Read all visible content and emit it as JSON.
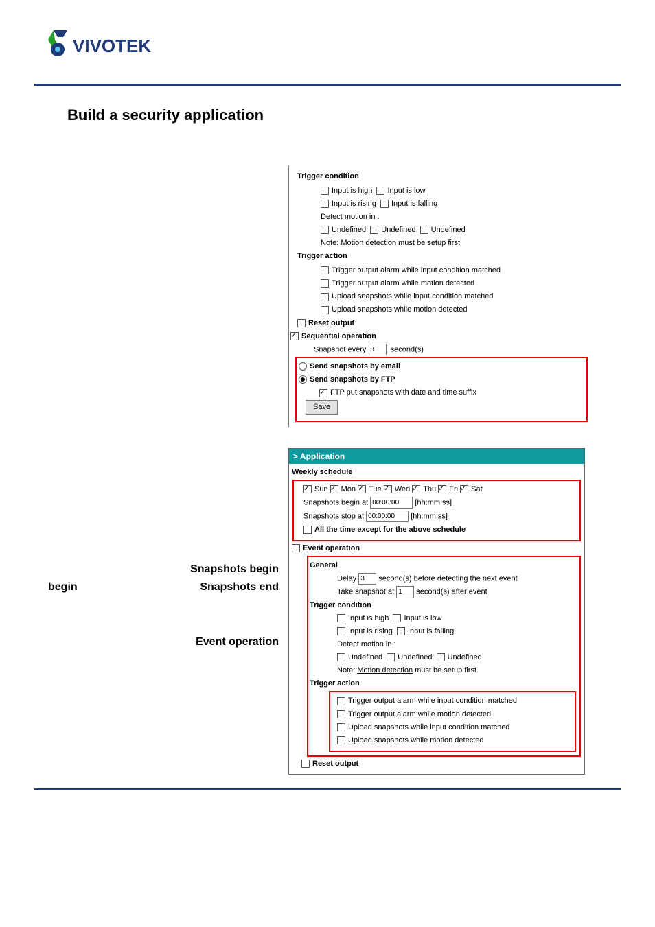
{
  "brand": "VIVOTEK",
  "main_title": "Build a security application",
  "left_labels": {
    "snapshots_begin": "Snapshots begin",
    "snapshots_end": "Snapshots end",
    "event_operation": "Event  operation"
  },
  "panel1": {
    "trigger_condition_head": "Trigger condition",
    "input_high": "Input is high",
    "input_low": "Input is low",
    "input_rising": "Input is rising",
    "input_falling": "Input is falling",
    "detect_motion": "Detect motion in :",
    "undefined": "Undefined",
    "note_prefix": "Note: ",
    "note_link": "Motion detection",
    "note_suffix": " must be setup first",
    "trigger_action_head": "Trigger action",
    "act1": "Trigger output alarm while input condition matched",
    "act2": "Trigger output alarm while motion detected",
    "act3": "Upload snapshots while input condition matched",
    "act4": "Upload snapshots while motion detected",
    "reset_output": "Reset output",
    "sequential_operation": "Sequential operation",
    "snapshot_every_pre": "Snapshot every",
    "snapshot_every_val": "3",
    "snapshot_every_post": "second(s)",
    "send_email": "Send snapshots by email",
    "send_ftp": "Send snapshots by FTP",
    "ftp_suffix": "FTP put snapshots with date and time suffix",
    "save_btn": "Save"
  },
  "panel2": {
    "application_head": "> Application",
    "weekly_schedule": "Weekly schedule",
    "days": {
      "sun": "Sun",
      "mon": "Mon",
      "tue": "Tue",
      "wed": "Wed",
      "thu": "Thu",
      "fri": "Fri",
      "sat": "Sat"
    },
    "snap_begin_pre": "Snapshots begin at",
    "snap_begin_val": "00:00:00",
    "snap_stop_pre": "Snapshots stop at",
    "snap_stop_val": "00:00:00",
    "hhmmss": "[hh:mm:ss]",
    "all_time_except": "All the time except for the above schedule",
    "event_operation": "Event operation",
    "general": "General",
    "delay_pre": "Delay",
    "delay_val": "3",
    "delay_post": "second(s) before detecting the next event",
    "take_snap_pre": "Take snapshot at",
    "take_snap_val": "1",
    "take_snap_post": "second(s) after event",
    "trigger_condition_head": "Trigger condition",
    "input_high": "Input is high",
    "input_low": "Input is low",
    "input_rising": "Input is rising",
    "input_falling": "Input is falling",
    "detect_motion": "Detect motion in :",
    "undefined": "Undefined",
    "note_prefix": "Note: ",
    "note_link": "Motion detection",
    "note_suffix": " must be setup first",
    "trigger_action_head": "Trigger action",
    "act1": "Trigger output alarm while input condition matched",
    "act2": "Trigger output alarm while motion detected",
    "act3": "Upload snapshots while input condition matched",
    "act4": "Upload snapshots while motion detected",
    "reset_output": "Reset output"
  }
}
